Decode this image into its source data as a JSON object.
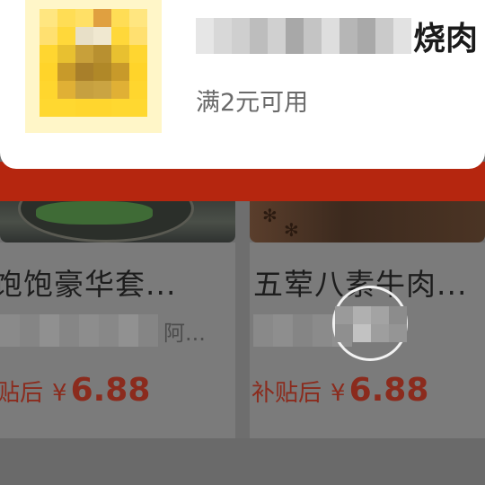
{
  "coupon": {
    "name": "烧肉",
    "condition": "满2元可用"
  },
  "products": [
    {
      "title": "饱饱豪华套...",
      "subtitle": "阿...",
      "price_tag": "贴后",
      "currency": "¥",
      "price": "6.88"
    },
    {
      "title": "五荤八素牛肉...",
      "subtitle": "",
      "price_tag": "补贴后",
      "currency": "¥",
      "price": "6.88"
    }
  ],
  "colors": {
    "accent_red": "#d32a12",
    "price_red": "#e8381e",
    "overlay": "rgba(0,0,0,0.5)"
  },
  "icons": {
    "close": "close-icon"
  }
}
